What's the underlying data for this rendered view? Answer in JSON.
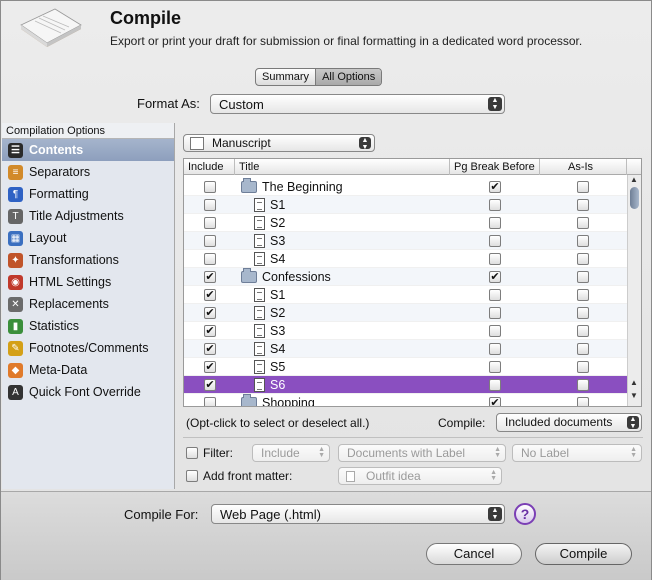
{
  "header": {
    "title": "Compile",
    "subtitle": "Export or print your draft for submission or final formatting in a dedicated word processor."
  },
  "view_tabs": [
    {
      "label": "Summary",
      "selected": false
    },
    {
      "label": "All Options",
      "selected": true
    }
  ],
  "format_as": {
    "label": "Format As:",
    "value": "Custom"
  },
  "sidebar": {
    "header": "Compilation Options",
    "items": [
      {
        "label": "Contents",
        "icon": "contents-icon",
        "color": "#2a2a2a",
        "glyph": "☰",
        "selected": true
      },
      {
        "label": "Separators",
        "icon": "separators-icon",
        "color": "#d28a2a",
        "glyph": "≡",
        "selected": false
      },
      {
        "label": "Formatting",
        "icon": "formatting-icon",
        "color": "#2f62c4",
        "glyph": "¶",
        "selected": false
      },
      {
        "label": "Title Adjustments",
        "icon": "title-adjustments-icon",
        "color": "#666666",
        "glyph": "T",
        "selected": false
      },
      {
        "label": "Layout",
        "icon": "layout-icon",
        "color": "#3a6fc0",
        "glyph": "▦",
        "selected": false
      },
      {
        "label": "Transformations",
        "icon": "transformations-icon",
        "color": "#c0542a",
        "glyph": "✦",
        "selected": false
      },
      {
        "label": "HTML Settings",
        "icon": "html-settings-icon",
        "color": "#c0392b",
        "glyph": "◉",
        "selected": false
      },
      {
        "label": "Replacements",
        "icon": "replacements-icon",
        "color": "#6b6b6b",
        "glyph": "✕",
        "selected": false
      },
      {
        "label": "Statistics",
        "icon": "statistics-icon",
        "color": "#3b8f3b",
        "glyph": "▮",
        "selected": false
      },
      {
        "label": "Footnotes/Comments",
        "icon": "footnotes-icon",
        "color": "#d4a017",
        "glyph": "✎",
        "selected": false
      },
      {
        "label": "Meta-Data",
        "icon": "meta-data-icon",
        "color": "#e07a2a",
        "glyph": "◆",
        "selected": false
      },
      {
        "label": "Quick Font Override",
        "icon": "font-override-icon",
        "color": "#333333",
        "glyph": "A",
        "selected": false
      }
    ]
  },
  "manuscript_popup": {
    "value": "Manuscript"
  },
  "table": {
    "columns": [
      "Include",
      "Title",
      "Pg Break Before",
      "As-Is"
    ],
    "rows": [
      {
        "type": "folder",
        "title": "The Beginning",
        "include": false,
        "pgbreak": true,
        "asis": false,
        "indent": 0
      },
      {
        "type": "doc",
        "title": "S1",
        "include": false,
        "pgbreak": false,
        "asis": false,
        "indent": 1
      },
      {
        "type": "doc",
        "title": "S2",
        "include": false,
        "pgbreak": false,
        "asis": false,
        "indent": 1
      },
      {
        "type": "doc",
        "title": "S3",
        "include": false,
        "pgbreak": false,
        "asis": false,
        "indent": 1
      },
      {
        "type": "doc",
        "title": "S4",
        "include": false,
        "pgbreak": false,
        "asis": false,
        "indent": 1
      },
      {
        "type": "folder",
        "title": "Confessions",
        "include": true,
        "pgbreak": true,
        "asis": false,
        "indent": 0
      },
      {
        "type": "doc",
        "title": "S1",
        "include": true,
        "pgbreak": false,
        "asis": false,
        "indent": 1
      },
      {
        "type": "doc",
        "title": "S2",
        "include": true,
        "pgbreak": false,
        "asis": false,
        "indent": 1
      },
      {
        "type": "doc",
        "title": "S3",
        "include": true,
        "pgbreak": false,
        "asis": false,
        "indent": 1
      },
      {
        "type": "doc",
        "title": "S4",
        "include": true,
        "pgbreak": false,
        "asis": false,
        "indent": 1
      },
      {
        "type": "doc",
        "title": "S5",
        "include": true,
        "pgbreak": false,
        "asis": false,
        "indent": 1
      },
      {
        "type": "doc",
        "title": "S6",
        "include": true,
        "pgbreak": false,
        "asis": false,
        "indent": 1,
        "selected": true
      },
      {
        "type": "folder",
        "title": "Shopping",
        "include": false,
        "pgbreak": true,
        "asis": false,
        "indent": 0
      }
    ]
  },
  "hint": "(Opt-click to select or deselect all.)",
  "compile_scope": {
    "label": "Compile:",
    "value": "Included documents"
  },
  "filter": {
    "label": "Filter:",
    "mode": "Include",
    "by": "Documents with Label",
    "value": "No Label"
  },
  "front_matter": {
    "label": "Add front matter:",
    "value": "Outfit idea"
  },
  "compile_for": {
    "label": "Compile For:",
    "value": "Web Page (.html)"
  },
  "help": "?",
  "buttons": {
    "cancel": "Cancel",
    "compile": "Compile"
  },
  "accent": "#8a4fc0"
}
